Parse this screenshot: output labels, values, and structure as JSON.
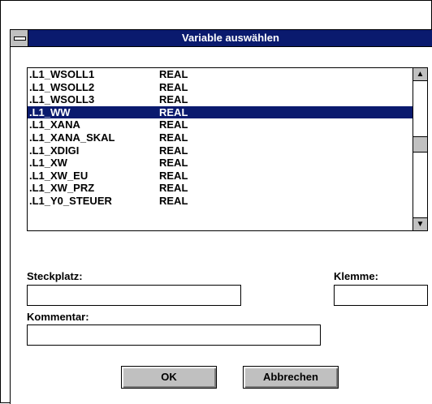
{
  "dialog": {
    "title": "Variable auswählen"
  },
  "variables": [
    {
      "name": ".L1_WSOLL1",
      "type": "REAL"
    },
    {
      "name": ".L1_WSOLL2",
      "type": "REAL"
    },
    {
      "name": ".L1_WSOLL3",
      "type": "REAL"
    },
    {
      "name": ".L1_WW",
      "type": "REAL"
    },
    {
      "name": ".L1_XANA",
      "type": "REAL"
    },
    {
      "name": ".L1_XANA_SKAL",
      "type": "REAL"
    },
    {
      "name": ".L1_XDIGI",
      "type": "REAL"
    },
    {
      "name": ".L1_XW",
      "type": "REAL"
    },
    {
      "name": ".L1_XW_EU",
      "type": "REAL"
    },
    {
      "name": ".L1_XW_PRZ",
      "type": "REAL"
    },
    {
      "name": ".L1_Y0_STEUER",
      "type": "REAL"
    }
  ],
  "selected_index": 3,
  "scrollbar": {
    "up_icon": "arrow-up-icon",
    "down_icon": "arrow-down-icon"
  },
  "form": {
    "steckplatz_label": "Steckplatz:",
    "steckplatz_value": "",
    "klemme_label": "Klemme:",
    "klemme_value": "",
    "kommentar_label": "Kommentar:",
    "kommentar_value": ""
  },
  "buttons": {
    "ok_label": "OK",
    "cancel_label": "Abbrechen"
  },
  "colors": {
    "titlebar": "#0a1a6e",
    "selection": "#0a1a6e",
    "button_face": "#c0c0c0"
  }
}
